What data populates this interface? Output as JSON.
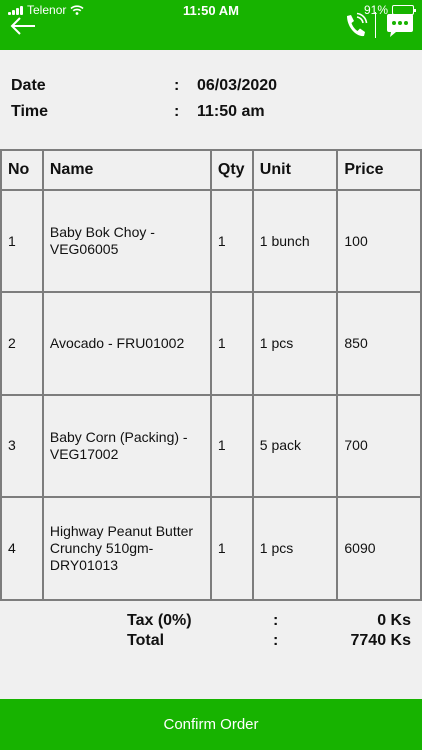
{
  "status_bar": {
    "carrier": "Telenor",
    "time": "11:50 AM",
    "battery": "91%",
    "battery_level": 0.91
  },
  "header": {
    "back_icon": "arrow-left-icon",
    "call_icon": "phone-icon",
    "chat_icon": "chat-bubble-icon"
  },
  "order_info": {
    "date_label": "Date",
    "date_value": "06/03/2020",
    "time_label": "Time",
    "time_value": "11:50 am",
    "separator": ":"
  },
  "table": {
    "headers": {
      "no": "No",
      "name": "Name",
      "qty": "Qty",
      "unit": "Unit",
      "price": "Price"
    },
    "rows": [
      {
        "no": "1",
        "name": "Baby Bok Choy - VEG06005",
        "qty": "1",
        "unit": "1 bunch",
        "price": "100"
      },
      {
        "no": "2",
        "name": "Avocado - FRU01002",
        "qty": "1",
        "unit": "1 pcs",
        "price": "850"
      },
      {
        "no": "3",
        "name": "Baby Corn (Packing) - VEG17002",
        "qty": "1",
        "unit": "5 pack",
        "price": "700"
      },
      {
        "no": "4",
        "name": "Highway Peanut Butter Crunchy 510gm-DRY01013",
        "qty": "1",
        "unit": "1 pcs",
        "price": "6090"
      }
    ]
  },
  "totals": {
    "tax_label": "Tax (0%)",
    "tax_value": "0 Ks",
    "total_label": "Total",
    "total_value": "7740 Ks",
    "separator": ":"
  },
  "confirm_button": {
    "label": "Confirm Order"
  },
  "colors": {
    "brand_green": "#17b300",
    "background": "#f0f0f0",
    "grid": "#7d7d7d"
  }
}
